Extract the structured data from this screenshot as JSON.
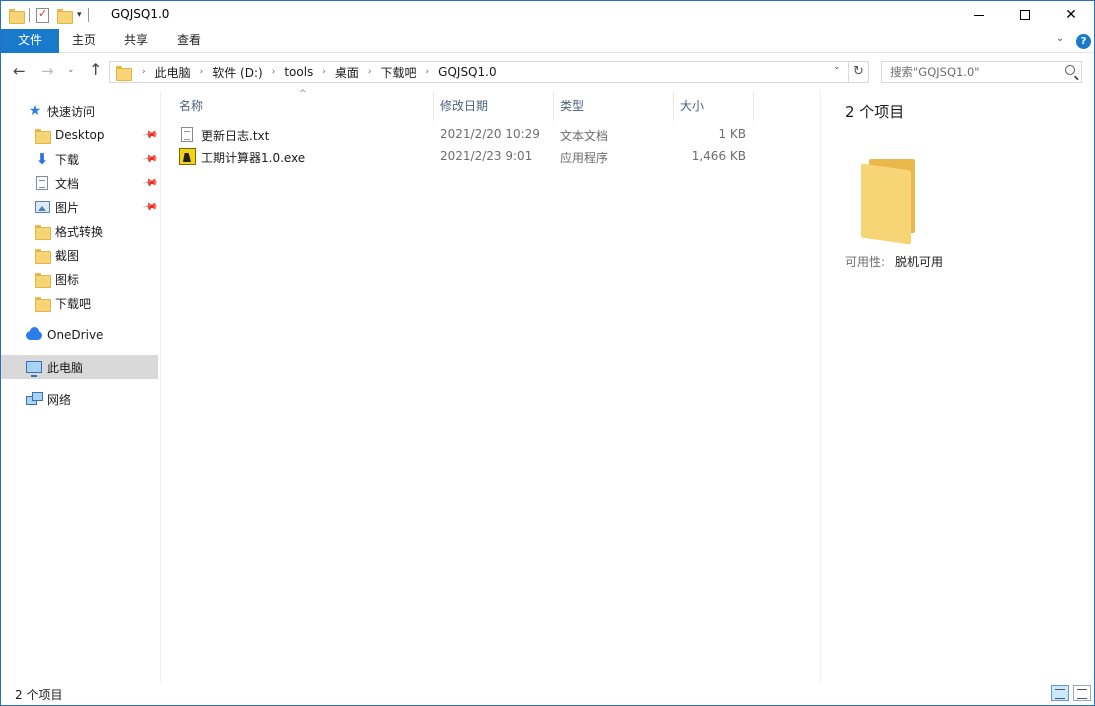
{
  "window": {
    "title": "GQJSQ1.0"
  },
  "ribbon": {
    "tabs": [
      {
        "label": "文件",
        "active": true
      },
      {
        "label": "主页"
      },
      {
        "label": "共享"
      },
      {
        "label": "查看"
      }
    ]
  },
  "address": {
    "crumbs": [
      "此电脑",
      "软件 (D:)",
      "tools",
      "桌面",
      "下载吧",
      "GQJSQ1.0"
    ]
  },
  "search": {
    "placeholder": "搜索\"GQJSQ1.0\""
  },
  "sidebar": {
    "items": [
      {
        "label": "快速访问",
        "icon": "star-icon"
      },
      {
        "label": "Desktop",
        "icon": "folder-icon",
        "pinned": true
      },
      {
        "label": "下载",
        "icon": "download-icon",
        "pinned": true
      },
      {
        "label": "文档",
        "icon": "document-icon",
        "pinned": true
      },
      {
        "label": "图片",
        "icon": "pictures-icon",
        "pinned": true
      },
      {
        "label": "格式转换",
        "icon": "folder-icon"
      },
      {
        "label": "截图",
        "icon": "folder-icon"
      },
      {
        "label": "图标",
        "icon": "folder-icon"
      },
      {
        "label": "下载吧",
        "icon": "folder-icon"
      },
      {
        "label": "OneDrive",
        "icon": "cloud-icon"
      },
      {
        "label": "此电脑",
        "icon": "computer-icon",
        "selected": true
      },
      {
        "label": "网络",
        "icon": "network-icon"
      }
    ]
  },
  "filelist": {
    "columns": [
      "名称",
      "修改日期",
      "类型",
      "大小"
    ],
    "rows": [
      {
        "name": "更新日志.txt",
        "date": "2021/2/20 10:29",
        "type": "文本文档",
        "size": "1 KB",
        "icon": "text-file-icon"
      },
      {
        "name": "工期计算器1.0.exe",
        "date": "2021/2/23 9:01",
        "type": "应用程序",
        "size": "1,466 KB",
        "icon": "exe-file-icon"
      }
    ]
  },
  "preview": {
    "title": "2 个项目",
    "availability_label": "可用性:",
    "availability_value": "脱机可用"
  },
  "status": {
    "text": "2 个项目"
  },
  "colors": {
    "accent": "#1979ca",
    "selected_nav": "#d9d9d9"
  }
}
